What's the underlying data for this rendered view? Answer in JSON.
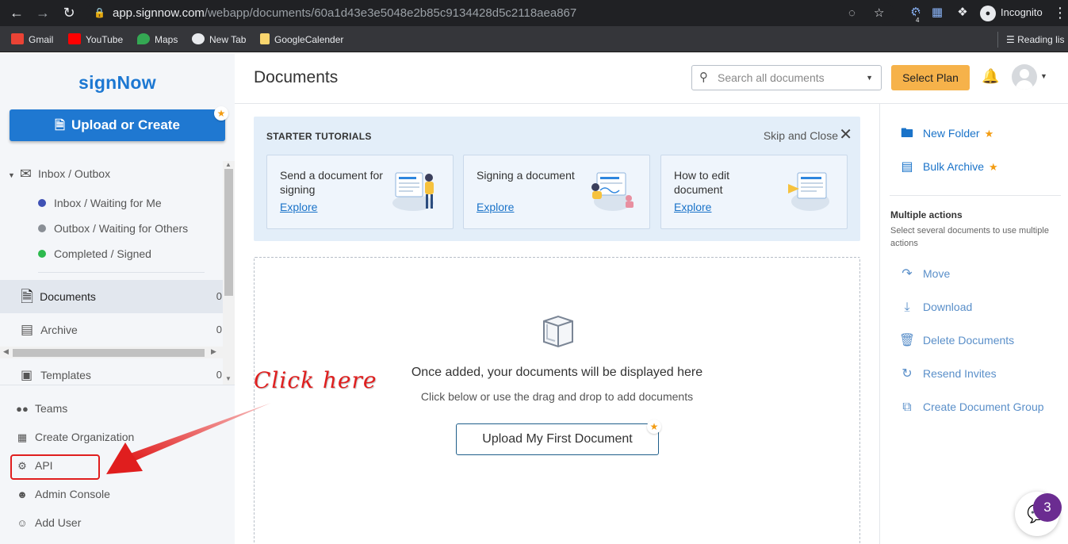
{
  "browser": {
    "url_host": "app.signnow.com",
    "url_path": "/webapp/documents/60a1d43e3e5048e2b85c9134428d5c2118aea867",
    "incognito_label": "Incognito",
    "bookmarks": [
      {
        "label": "Gmail",
        "icon": "gmail-icon",
        "color": "#ea4335"
      },
      {
        "label": "YouTube",
        "icon": "youtube-icon",
        "color": "#ff0000"
      },
      {
        "label": "Maps",
        "icon": "maps-icon",
        "color": "#34a853"
      },
      {
        "label": "New Tab",
        "icon": "globe-icon",
        "color": "#e8eaed"
      },
      {
        "label": "GoogleCalender",
        "icon": "folder-icon",
        "color": "#f9d56e"
      }
    ],
    "reading_list": "Reading lis",
    "extension_badge": "4"
  },
  "sidebar": {
    "logo": "signNow",
    "upload_button": "Upload or Create",
    "tree": {
      "inbox_outbox": "Inbox / Outbox",
      "items": [
        {
          "label": "Inbox / Waiting for Me",
          "color": "#3f51b5"
        },
        {
          "label": "Outbox / Waiting for Others",
          "color": "#8a8f96"
        },
        {
          "label": "Completed / Signed",
          "color": "#2dba4e"
        }
      ],
      "documents": "Documents",
      "documents_count": "0",
      "archive": "Archive",
      "archive_count": "0",
      "templates": "Templates",
      "templates_count": "0"
    },
    "links": {
      "teams": "Teams",
      "create_org": "Create Organization",
      "api": "API",
      "admin_console": "Admin Console",
      "add_user": "Add User"
    }
  },
  "annotation": {
    "click_here": "Click here"
  },
  "header": {
    "title": "Documents",
    "search_placeholder": "Search all documents",
    "select_plan": "Select Plan"
  },
  "tutorials": {
    "heading": "STARTER TUTORIALS",
    "skip_close": "Skip and Close",
    "cards": [
      {
        "text": "Send a document for signing",
        "link": "Explore"
      },
      {
        "text": "Signing a document",
        "link": "Explore"
      },
      {
        "text": "How to edit document",
        "link": "Explore"
      }
    ]
  },
  "dropzone": {
    "title": "Once added, your documents will be displayed here",
    "subtitle": "Click below or use the drag and drop to add documents",
    "button": "Upload My First Document"
  },
  "right_panel": {
    "new_folder": "New Folder",
    "bulk_archive": "Bulk Archive",
    "multiple_heading": "Multiple actions",
    "multiple_desc": "Select several documents to use multiple actions",
    "actions": {
      "move": "Move",
      "download": "Download",
      "delete": "Delete Documents",
      "resend": "Resend Invites",
      "create_group": "Create Document Group"
    }
  },
  "chat": {
    "badge": "3"
  },
  "colors": {
    "brand": "#1d78d2",
    "accent": "#f6b24a",
    "link": "#1a73c9",
    "annotation": "#e01e1e"
  }
}
